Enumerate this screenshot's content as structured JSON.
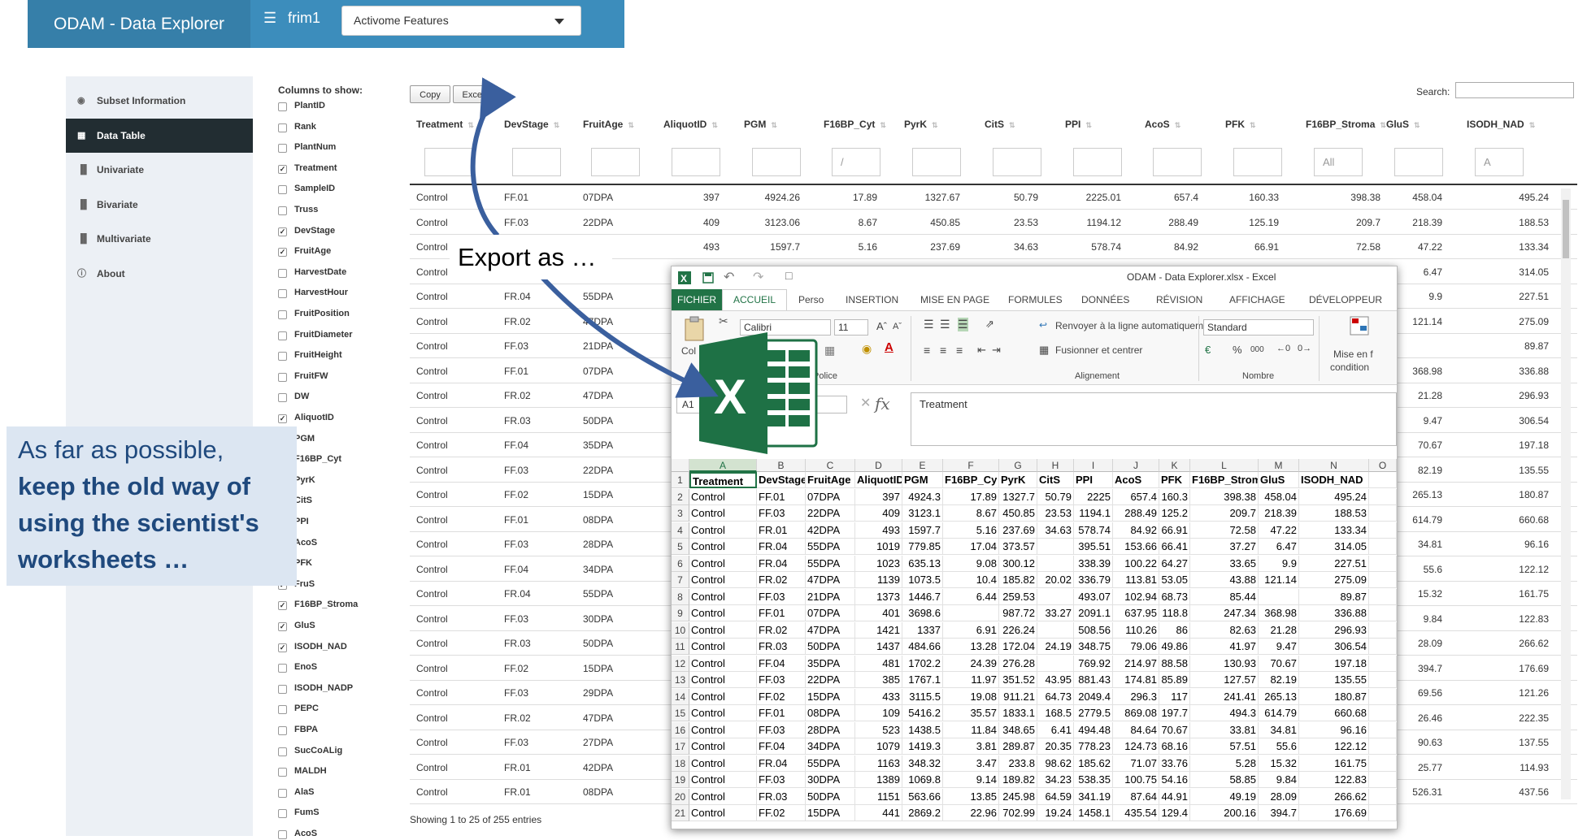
{
  "header": {
    "brand": "ODAM - Data Explorer",
    "menu_icon": "hamburger-icon",
    "user": "frim1",
    "select_value": "Activome Features"
  },
  "sidebar": {
    "items": [
      {
        "label": "Subset Information",
        "icon": "eye-icon"
      },
      {
        "label": "Data Table",
        "icon": "table-icon"
      },
      {
        "label": "Univariate",
        "icon": "bar-chart-icon"
      },
      {
        "label": "Bivariate",
        "icon": "bar-chart-icon"
      },
      {
        "label": "Multivariate",
        "icon": "bar-chart-icon"
      },
      {
        "label": "About",
        "icon": "info-icon"
      }
    ]
  },
  "columns_panel": {
    "title": "Columns to show:",
    "items": [
      {
        "label": "PlantID",
        "checked": false
      },
      {
        "label": "Rank",
        "checked": false
      },
      {
        "label": "PlantNum",
        "checked": false
      },
      {
        "label": "Treatment",
        "checked": true
      },
      {
        "label": "SampleID",
        "checked": false
      },
      {
        "label": "Truss",
        "checked": false
      },
      {
        "label": "DevStage",
        "checked": true
      },
      {
        "label": "FruitAge",
        "checked": true
      },
      {
        "label": "HarvestDate",
        "checked": false
      },
      {
        "label": "HarvestHour",
        "checked": false
      },
      {
        "label": "FruitPosition",
        "checked": false
      },
      {
        "label": "FruitDiameter",
        "checked": false
      },
      {
        "label": "FruitHeight",
        "checked": false
      },
      {
        "label": "FruitFW",
        "checked": false
      },
      {
        "label": "DW",
        "checked": false
      },
      {
        "label": "AliquotID",
        "checked": true
      },
      {
        "label": "PGM",
        "checked": true
      },
      {
        "label": "F16BP_Cyt",
        "checked": true
      },
      {
        "label": "PyrK",
        "checked": true
      },
      {
        "label": "CitS",
        "checked": true
      },
      {
        "label": "PPI",
        "checked": true
      },
      {
        "label": "AcoS",
        "checked": true
      },
      {
        "label": "PFK",
        "checked": true
      },
      {
        "label": "FruS",
        "checked": true
      },
      {
        "label": "F16BP_Stroma",
        "checked": true
      },
      {
        "label": "GluS",
        "checked": true
      },
      {
        "label": "ISODH_NAD",
        "checked": true
      },
      {
        "label": "EnoS",
        "checked": false
      },
      {
        "label": "ISODH_NADP",
        "checked": false
      },
      {
        "label": "PEPC",
        "checked": false
      },
      {
        "label": "FBPA",
        "checked": false
      },
      {
        "label": "SucCoALig",
        "checked": false
      },
      {
        "label": "MALDH",
        "checked": false
      },
      {
        "label": "AlaS",
        "checked": false
      },
      {
        "label": "FumS",
        "checked": false
      },
      {
        "label": "AcoS",
        "checked": false
      }
    ]
  },
  "toolbar": {
    "copy": "Copy",
    "excel": "Excel",
    "search_label": "Search:"
  },
  "table": {
    "headers": [
      "Treatment",
      "DevStage",
      "FruitAge",
      "AliquotID",
      "PGM",
      "F16BP_Cyt",
      "PyrK",
      "CitS",
      "PPI",
      "AcoS",
      "PFK",
      "F16BP_Stroma",
      "GluS",
      "ISODH_NAD"
    ],
    "filters": [
      "",
      "",
      "",
      "",
      "",
      "/",
      "",
      "",
      "",
      "",
      "",
      "All",
      "",
      "A"
    ],
    "rows": [
      [
        "Control",
        "FF.01",
        "07DPA",
        "397",
        "4924.26",
        "17.89",
        "1327.67",
        "50.79",
        "2225.01",
        "657.4",
        "160.33",
        "398.38",
        "458.04",
        "495.24"
      ],
      [
        "Control",
        "FF.03",
        "22DPA",
        "409",
        "3123.06",
        "8.67",
        "450.85",
        "23.53",
        "1194.12",
        "288.49",
        "125.19",
        "209.7",
        "218.39",
        "188.53"
      ],
      [
        "Control",
        "",
        "",
        "493",
        "1597.7",
        "5.16",
        "237.69",
        "34.63",
        "578.74",
        "84.92",
        "66.91",
        "72.58",
        "47.22",
        "133.34"
      ],
      [
        "Control",
        "",
        "",
        "",
        "",
        "",
        "",
        "",
        "",
        "",
        "",
        "",
        "6.47",
        "314.05"
      ],
      [
        "Control",
        "FR.04",
        "55DPA",
        "",
        "",
        "",
        "",
        "",
        "",
        "",
        "",
        "",
        "9.9",
        "227.51"
      ],
      [
        "Control",
        "FR.02",
        "47DPA",
        "",
        "",
        "",
        "",
        "",
        "",
        "",
        "",
        "",
        "121.14",
        "275.09"
      ],
      [
        "Control",
        "FF.03",
        "21DPA",
        "",
        "",
        "",
        "",
        "",
        "",
        "",
        "",
        "",
        "",
        "89.87"
      ],
      [
        "Control",
        "FF.01",
        "07DPA",
        "",
        "",
        "",
        "",
        "",
        "",
        "",
        "",
        "",
        "368.98",
        "336.88"
      ],
      [
        "Control",
        "FR.02",
        "47DPA",
        "",
        "",
        "",
        "",
        "",
        "",
        "",
        "",
        "",
        "21.28",
        "296.93"
      ],
      [
        "Control",
        "FR.03",
        "50DPA",
        "",
        "",
        "",
        "",
        "",
        "",
        "",
        "",
        "",
        "9.47",
        "306.54"
      ],
      [
        "Control",
        "FF.04",
        "35DPA",
        "",
        "",
        "",
        "",
        "",
        "",
        "",
        "",
        "",
        "70.67",
        "197.18"
      ],
      [
        "Control",
        "FF.03",
        "22DPA",
        "",
        "",
        "",
        "",
        "",
        "",
        "",
        "",
        "",
        "82.19",
        "135.55"
      ],
      [
        "Control",
        "FF.02",
        "15DPA",
        "",
        "",
        "",
        "",
        "",
        "",
        "",
        "",
        "",
        "265.13",
        "180.87"
      ],
      [
        "Control",
        "FF.01",
        "08DPA",
        "",
        "",
        "",
        "",
        "",
        "",
        "",
        "",
        "",
        "614.79",
        "660.68"
      ],
      [
        "Control",
        "FF.03",
        "28DPA",
        "",
        "",
        "",
        "",
        "",
        "",
        "",
        "",
        "",
        "34.81",
        "96.16"
      ],
      [
        "Control",
        "FF.04",
        "34DPA",
        "",
        "",
        "",
        "",
        "",
        "",
        "",
        "",
        "",
        "55.6",
        "122.12"
      ],
      [
        "Control",
        "FR.04",
        "55DPA",
        "",
        "",
        "",
        "",
        "",
        "",
        "",
        "",
        "",
        "15.32",
        "161.75"
      ],
      [
        "Control",
        "FF.03",
        "30DPA",
        "",
        "",
        "",
        "",
        "",
        "",
        "",
        "",
        "",
        "9.84",
        "122.83"
      ],
      [
        "Control",
        "FR.03",
        "50DPA",
        "",
        "",
        "",
        "",
        "",
        "",
        "",
        "",
        "",
        "28.09",
        "266.62"
      ],
      [
        "Control",
        "FF.02",
        "15DPA",
        "",
        "",
        "",
        "",
        "",
        "",
        "",
        "",
        "",
        "394.7",
        "176.69"
      ],
      [
        "Control",
        "FF.03",
        "29DPA",
        "",
        "",
        "",
        "",
        "",
        "",
        "",
        "",
        "",
        "69.56",
        "121.26"
      ],
      [
        "Control",
        "FR.02",
        "47DPA",
        "",
        "",
        "",
        "",
        "",
        "",
        "",
        "",
        "",
        "26.46",
        "222.35"
      ],
      [
        "Control",
        "FF.03",
        "27DPA",
        "",
        "",
        "",
        "",
        "",
        "",
        "",
        "",
        "",
        "90.63",
        "137.55"
      ],
      [
        "Control",
        "FR.01",
        "42DPA",
        "",
        "",
        "",
        "",
        "",
        "",
        "",
        "",
        "",
        "25.77",
        "114.93"
      ],
      [
        "Control",
        "FR.01",
        "08DPA",
        "",
        "",
        "",
        "",
        "",
        "",
        "",
        "",
        "",
        "526.31",
        "437.56"
      ]
    ],
    "footer": "Showing 1 to 25 of 255 entries"
  },
  "excel": {
    "title": "ODAM - Data Explorer.xlsx - Excel",
    "tabs": [
      "FICHIER",
      "ACCUEIL",
      "Perso",
      "INSERTION",
      "MISE EN PAGE",
      "FORMULES",
      "DONNÉES",
      "RÉVISION",
      "AFFICHAGE",
      "DÉVELOPPEUR"
    ],
    "font": "Calibri",
    "font_size": "11",
    "wrap": "Renvoyer à la ligne automatiquement",
    "merge": "Fusionner et centrer",
    "number_format": "Standard",
    "group_police": "Police",
    "group_alignement": "Alignement",
    "group_nombre": "Nombre",
    "paste_label": "Col",
    "cond_format": "Mise en f",
    "cond_format2": "condition",
    "namebox": "A1",
    "formula": "Treatment",
    "col_letters": [
      "A",
      "B",
      "C",
      "D",
      "E",
      "F",
      "G",
      "H",
      "I",
      "J",
      "K",
      "L",
      "M",
      "N",
      "O"
    ],
    "rows": [
      [
        "Treatment",
        "DevStage",
        "FruitAge",
        "AliquotID",
        "PGM",
        "F16BP_Cy",
        "PyrK",
        "CitS",
        "PPI",
        "AcoS",
        "PFK",
        "F16BP_Strom",
        "GluS",
        "ISODH_NAD"
      ],
      [
        "Control",
        "FF.01",
        "07DPA",
        "397",
        "4924.3",
        "17.89",
        "1327.7",
        "50.79",
        "2225",
        "657.4",
        "160.3",
        "398.38",
        "458.04",
        "495.24"
      ],
      [
        "Control",
        "FF.03",
        "22DPA",
        "409",
        "3123.1",
        "8.67",
        "450.85",
        "23.53",
        "1194.1",
        "288.49",
        "125.2",
        "209.7",
        "218.39",
        "188.53"
      ],
      [
        "Control",
        "FR.01",
        "42DPA",
        "493",
        "1597.7",
        "5.16",
        "237.69",
        "34.63",
        "578.74",
        "84.92",
        "66.91",
        "72.58",
        "47.22",
        "133.34"
      ],
      [
        "Control",
        "FR.04",
        "55DPA",
        "1019",
        "779.85",
        "17.04",
        "373.57",
        "",
        "395.51",
        "153.66",
        "66.41",
        "37.27",
        "6.47",
        "314.05"
      ],
      [
        "Control",
        "FR.04",
        "55DPA",
        "1023",
        "635.13",
        "9.08",
        "300.12",
        "",
        "338.39",
        "100.22",
        "64.27",
        "33.65",
        "9.9",
        "227.51"
      ],
      [
        "Control",
        "FR.02",
        "47DPA",
        "1139",
        "1073.5",
        "10.4",
        "185.82",
        "20.02",
        "336.79",
        "113.81",
        "53.05",
        "43.88",
        "121.14",
        "275.09"
      ],
      [
        "Control",
        "FF.03",
        "21DPA",
        "1373",
        "1446.7",
        "6.44",
        "259.53",
        "",
        "493.07",
        "102.94",
        "68.73",
        "85.44",
        "",
        "89.87"
      ],
      [
        "Control",
        "FF.01",
        "07DPA",
        "401",
        "3698.6",
        "",
        "987.72",
        "33.27",
        "2091.1",
        "637.95",
        "118.8",
        "247.34",
        "368.98",
        "336.88"
      ],
      [
        "Control",
        "FR.02",
        "47DPA",
        "1421",
        "1337",
        "6.91",
        "226.24",
        "",
        "508.56",
        "110.26",
        "86",
        "82.63",
        "21.28",
        "296.93"
      ],
      [
        "Control",
        "FR.03",
        "50DPA",
        "1437",
        "484.66",
        "13.28",
        "172.04",
        "24.19",
        "348.75",
        "79.06",
        "49.86",
        "41.97",
        "9.47",
        "306.54"
      ],
      [
        "Control",
        "FF.04",
        "35DPA",
        "481",
        "1702.2",
        "24.39",
        "276.28",
        "",
        "769.92",
        "214.97",
        "88.58",
        "130.93",
        "70.67",
        "197.18"
      ],
      [
        "Control",
        "FF.03",
        "22DPA",
        "385",
        "1767.1",
        "11.97",
        "351.52",
        "43.95",
        "881.43",
        "174.81",
        "85.89",
        "127.57",
        "82.19",
        "135.55"
      ],
      [
        "Control",
        "FF.02",
        "15DPA",
        "433",
        "3115.5",
        "19.08",
        "911.21",
        "64.73",
        "2049.4",
        "296.3",
        "117",
        "241.41",
        "265.13",
        "180.87"
      ],
      [
        "Control",
        "FF.01",
        "08DPA",
        "109",
        "5416.2",
        "35.57",
        "1833.1",
        "168.5",
        "2779.5",
        "869.08",
        "197.7",
        "494.3",
        "614.79",
        "660.68"
      ],
      [
        "Control",
        "FF.03",
        "28DPA",
        "523",
        "1438.5",
        "11.84",
        "348.65",
        "6.41",
        "494.48",
        "84.64",
        "70.67",
        "33.81",
        "34.81",
        "96.16"
      ],
      [
        "Control",
        "FF.04",
        "34DPA",
        "1079",
        "1419.3",
        "3.81",
        "289.87",
        "20.35",
        "778.23",
        "124.73",
        "68.16",
        "57.51",
        "55.6",
        "122.12"
      ],
      [
        "Control",
        "FR.04",
        "55DPA",
        "1163",
        "348.32",
        "3.47",
        "233.8",
        "98.62",
        "185.62",
        "71.07",
        "33.76",
        "5.28",
        "15.32",
        "161.75"
      ],
      [
        "Control",
        "FF.03",
        "30DPA",
        "1389",
        "1069.8",
        "9.14",
        "189.82",
        "34.23",
        "538.35",
        "100.75",
        "54.16",
        "58.85",
        "9.84",
        "122.83"
      ],
      [
        "Control",
        "FR.03",
        "50DPA",
        "1151",
        "563.66",
        "13.85",
        "245.98",
        "64.59",
        "341.19",
        "87.64",
        "44.91",
        "49.19",
        "28.09",
        "266.62"
      ],
      [
        "Control",
        "FF.02",
        "15DPA",
        "441",
        "2869.2",
        "22.96",
        "702.99",
        "19.24",
        "1458.1",
        "435.54",
        "129.4",
        "200.16",
        "394.7",
        "176.69"
      ]
    ]
  },
  "callouts": {
    "export": "Export as …",
    "note_line1": "As far as possible,",
    "note_line2": "keep the old way of",
    "note_line3": "using the scientist's",
    "note_line4": "worksheets …"
  },
  "colors": {
    "header": "#3c8dbc",
    "brand": "#367fa9",
    "active": "#222d32",
    "excel": "#217346",
    "note_bg": "#dce6f2",
    "note_text": "#1f497d",
    "arrow": "#3a5f9e"
  }
}
